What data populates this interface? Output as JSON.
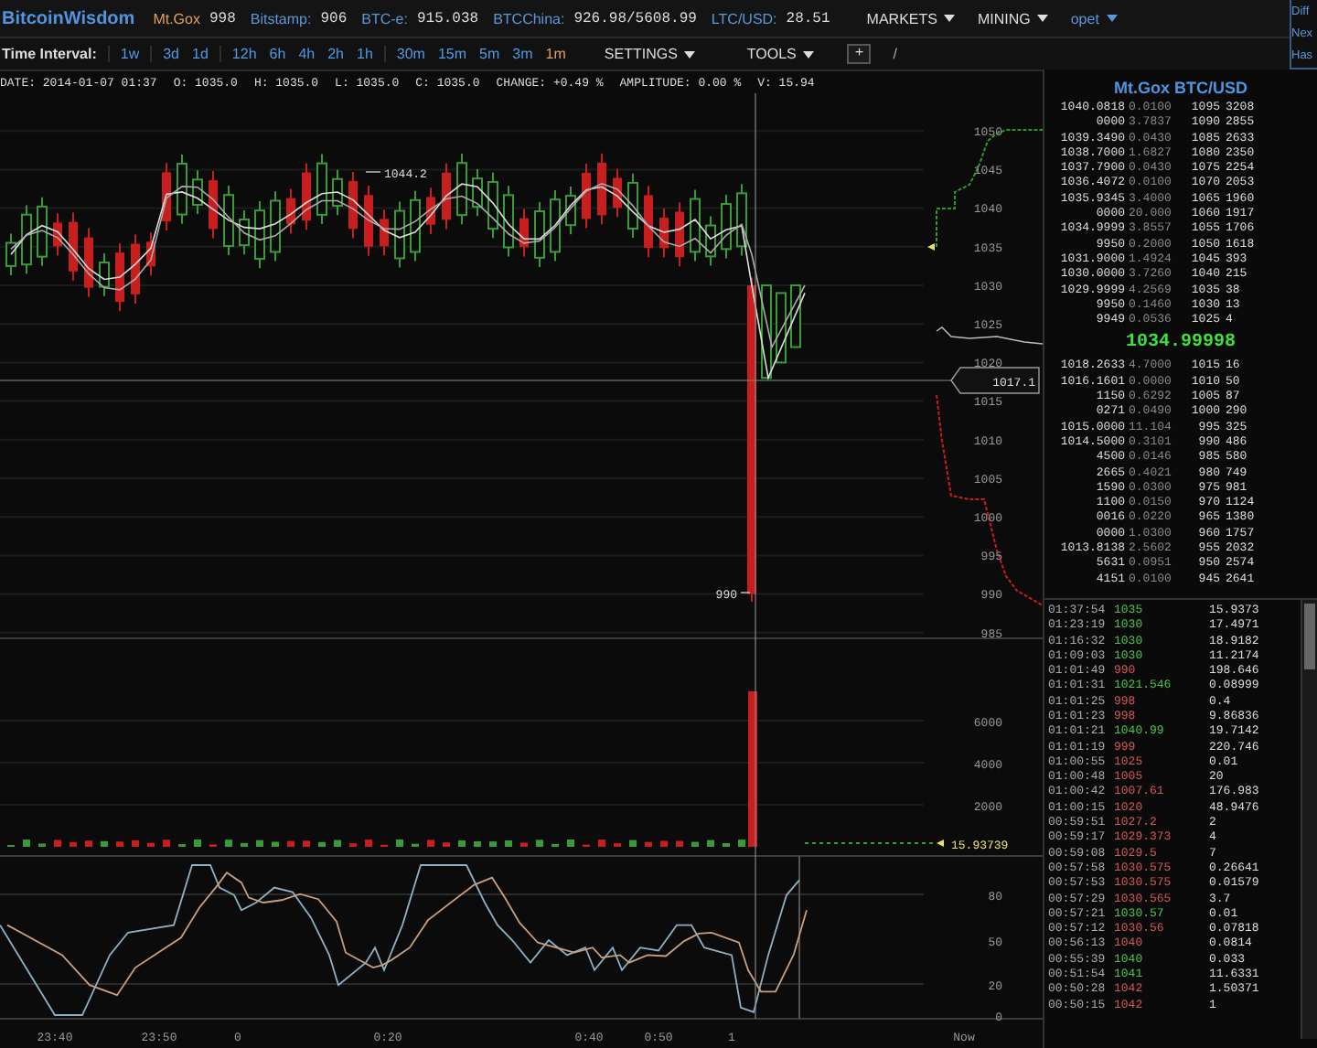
{
  "header": {
    "brand": "BitcoinWisdom",
    "tickers": [
      {
        "label": "Mt.Gox",
        "value": "998",
        "selected": true
      },
      {
        "label": "Bitstamp:",
        "value": "906",
        "selected": false
      },
      {
        "label": "BTC-e:",
        "value": "915.038",
        "selected": false
      },
      {
        "label": "BTCChina:",
        "value": "926.98/5608.99",
        "selected": false
      },
      {
        "label": "LTC/USD:",
        "value": "28.51",
        "selected": false
      }
    ],
    "menus": [
      {
        "label": "MARKETS",
        "kind": "menu"
      },
      {
        "label": "MINING",
        "kind": "menu"
      },
      {
        "label": "opet",
        "kind": "user"
      }
    ],
    "side_panel": [
      "Diff",
      "Nex",
      "Has"
    ]
  },
  "toolbar": {
    "label": "Time Interval:",
    "interval_groups": [
      [
        {
          "label": "1w",
          "selected": false
        }
      ],
      [
        {
          "label": "3d",
          "selected": false
        },
        {
          "label": "1d",
          "selected": false
        }
      ],
      [
        {
          "label": "12h",
          "selected": false
        },
        {
          "label": "6h",
          "selected": false
        },
        {
          "label": "4h",
          "selected": false
        },
        {
          "label": "2h",
          "selected": false
        },
        {
          "label": "1h",
          "selected": false
        }
      ],
      [
        {
          "label": "30m",
          "selected": false
        },
        {
          "label": "15m",
          "selected": false
        },
        {
          "label": "5m",
          "selected": false
        },
        {
          "label": "3m",
          "selected": false
        },
        {
          "label": "1m",
          "selected": true
        }
      ]
    ],
    "menus": [
      "SETTINGS",
      "TOOLS"
    ],
    "add_button": "+",
    "draw_tool": "/"
  },
  "info": [
    "DATE: 2014-01-07 01:37",
    "O: 1035.0",
    "H: 1035.0",
    "L: 1035.0",
    "C: 1035.0",
    "CHANGE: +0.49 %",
    "AMPLITUDE: 0.00 %",
    "V: 15.94"
  ],
  "chart": {
    "price_ticks": [
      "1050",
      "1045",
      "1040",
      "1035",
      "1030",
      "1025",
      "1020",
      "1015",
      "1010",
      "1005",
      "1000",
      "995",
      "990",
      "985"
    ],
    "volume_ticks": [
      "6000",
      "4000",
      "2000"
    ],
    "oscillator_ticks": [
      "80",
      "50",
      "20",
      "0"
    ],
    "time_ticks": [
      "23:40",
      "23:50",
      "0",
      "0:20",
      "0:40",
      "0:50",
      "1"
    ],
    "now_label": "Now",
    "high_label": "1044.2",
    "low_label": "990",
    "cursor_price": "1017.1",
    "last_volume": "15.93739"
  },
  "order_book": {
    "title": "Mt.Gox BTC/USD",
    "asks": [
      [
        "1040.0818",
        "0.0100",
        "1095",
        "3208"
      ],
      [
        "0000",
        "3.7837",
        "1090",
        "2855"
      ],
      [
        "1039.3490",
        "0.0430",
        "1085",
        "2633"
      ],
      [
        "1038.7000",
        "1.6827",
        "1080",
        "2350"
      ],
      [
        "1037.7900",
        "0.0430",
        "1075",
        "2254"
      ],
      [
        "1036.4072",
        "0.0100",
        "1070",
        "2053"
      ],
      [
        "1035.9345",
        "3.4000",
        "1065",
        "1960"
      ],
      [
        "0000",
        "20.000",
        "1060",
        "1917"
      ],
      [
        "1034.9999",
        "3.8557",
        "1055",
        "1706"
      ],
      [
        "9950",
        "0.2000",
        "1050",
        "1618"
      ],
      [
        "1031.9000",
        "1.4924",
        "1045",
        "393"
      ],
      [
        "1030.0000",
        "3.7260",
        "1040",
        "215"
      ],
      [
        "1029.9999",
        "4.2569",
        "1035",
        "38"
      ],
      [
        "9950",
        "0.1460",
        "1030",
        "13"
      ],
      [
        "9949",
        "0.0536",
        "1025",
        "4"
      ]
    ],
    "last_price": "1034.99998",
    "bids": [
      [
        "1018.2633",
        "4.7000",
        "1015",
        "16"
      ],
      [
        "1016.1601",
        "0.0000",
        "1010",
        "50"
      ],
      [
        "1150",
        "0.6292",
        "1005",
        "87"
      ],
      [
        "0271",
        "0.0490",
        "1000",
        "290"
      ],
      [
        "1015.0000",
        "11.104",
        "995",
        "325"
      ],
      [
        "1014.5000",
        "0.3101",
        "990",
        "486"
      ],
      [
        "4500",
        "0.0146",
        "985",
        "580"
      ],
      [
        "2665",
        "0.4021",
        "980",
        "749"
      ],
      [
        "1590",
        "0.0300",
        "975",
        "981"
      ],
      [
        "1100",
        "0.0150",
        "970",
        "1124"
      ],
      [
        "0016",
        "0.0220",
        "965",
        "1380"
      ],
      [
        "0000",
        "1.0300",
        "960",
        "1757"
      ],
      [
        "1013.8138",
        "2.5602",
        "955",
        "2032"
      ],
      [
        "5631",
        "0.0951",
        "950",
        "2574"
      ],
      [
        "4151",
        "0.0100",
        "945",
        "2641"
      ]
    ]
  },
  "trades": [
    {
      "time": "01:37:54",
      "price": "1035",
      "amount": "15.9373",
      "kind": "buy"
    },
    {
      "time": "01:23:19",
      "price": "1030",
      "amount": "17.4971",
      "kind": "buy"
    },
    {
      "time": "01:16:32",
      "price": "1030",
      "amount": "18.9182",
      "kind": "buy"
    },
    {
      "time": "01:09:03",
      "price": "1030",
      "amount": "11.2174",
      "kind": "buy"
    },
    {
      "time": "01:01:49",
      "price": "990",
      "amount": "198.646",
      "kind": "sell"
    },
    {
      "time": "01:01:31",
      "price": "1021.546",
      "amount": "0.08999",
      "kind": "buy"
    },
    {
      "time": "01:01:25",
      "price": "998",
      "amount": "0.4",
      "kind": "sell"
    },
    {
      "time": "01:01:23",
      "price": "998",
      "amount": "9.86836",
      "kind": "sell"
    },
    {
      "time": "01:01:21",
      "price": "1040.99",
      "amount": "19.7142",
      "kind": "buy"
    },
    {
      "time": "01:01:19",
      "price": "999",
      "amount": "220.746",
      "kind": "sell"
    },
    {
      "time": "01:00:55",
      "price": "1025",
      "amount": "0.01",
      "kind": "sell"
    },
    {
      "time": "01:00:48",
      "price": "1005",
      "amount": "20",
      "kind": "sell"
    },
    {
      "time": "01:00:42",
      "price": "1007.61",
      "amount": "176.983",
      "kind": "sell"
    },
    {
      "time": "01:00:15",
      "price": "1020",
      "amount": "48.9476",
      "kind": "sell"
    },
    {
      "time": "00:59:51",
      "price": "1027.2",
      "amount": "2",
      "kind": "sell"
    },
    {
      "time": "00:59:17",
      "price": "1029.373",
      "amount": "4",
      "kind": "sell"
    },
    {
      "time": "00:59:08",
      "price": "1029.5",
      "amount": "7",
      "kind": "sell"
    },
    {
      "time": "00:57:58",
      "price": "1030.575",
      "amount": "0.26641",
      "kind": "sell"
    },
    {
      "time": "00:57:53",
      "price": "1030.575",
      "amount": "0.01579",
      "kind": "sell"
    },
    {
      "time": "00:57:29",
      "price": "1030.565",
      "amount": "3.7",
      "kind": "sell"
    },
    {
      "time": "00:57:21",
      "price": "1030.57",
      "amount": "0.01",
      "kind": "buy"
    },
    {
      "time": "00:57:12",
      "price": "1030.56",
      "amount": "0.07818",
      "kind": "sell"
    },
    {
      "time": "00:56:13",
      "price": "1040",
      "amount": "0.0814",
      "kind": "sell"
    },
    {
      "time": "00:55:39",
      "price": "1040",
      "amount": "0.033",
      "kind": "buy"
    },
    {
      "time": "00:51:54",
      "price": "1041",
      "amount": "11.6331",
      "kind": "buy"
    },
    {
      "time": "00:50:28",
      "price": "1042",
      "amount": "1.50371",
      "kind": "sell"
    },
    {
      "time": "00:50:15",
      "price": "1042",
      "amount": "1",
      "kind": "sell"
    }
  ]
}
